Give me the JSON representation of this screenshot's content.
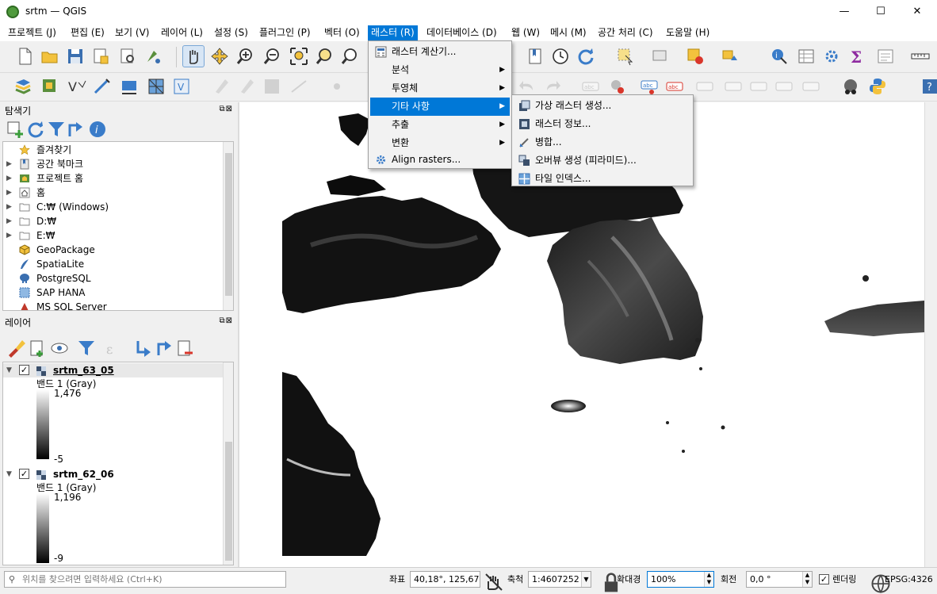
{
  "window": {
    "title": "srtm — QGIS",
    "minimize": "—",
    "maximize": "☐",
    "close": "✕"
  },
  "menubar": [
    "프로젝트 (J)",
    "편집 (E)",
    "보기 (V)",
    "레이어 (L)",
    "설정 (S)",
    "플러그인 (P)",
    "벡터 (O)",
    "래스터 (R)",
    "데이터베이스 (D)",
    "웹 (W)",
    "메시 (M)",
    "공간 처리 (C)",
    "도움말 (H)"
  ],
  "raster_menu": {
    "items": [
      "래스터 계산기...",
      "분석",
      "투영체",
      "기타 사항",
      "추출",
      "변환",
      "Align rasters..."
    ],
    "highlighted": "기타 사항"
  },
  "misc_submenu": {
    "items": [
      "가상 래스터 생성...",
      "래스터 정보...",
      "병합...",
      "오버뷰 생성 (피라미드)...",
      "타일 인덱스..."
    ]
  },
  "browser_panel": {
    "title": "탐색기",
    "items": [
      "즐겨찾기",
      "공간 북마크",
      "프로젝트 홈",
      "홈",
      "C:₩ (Windows)",
      "D:₩",
      "E:₩",
      "GeoPackage",
      "SpatiaLite",
      "PostgreSQL",
      "SAP HANA",
      "MS SQL Server"
    ]
  },
  "layers_panel": {
    "title": "레이어",
    "layers": [
      {
        "name": "srtm_63_05",
        "band": "밴드 1 (Gray)",
        "max": "1,476",
        "min": "-5"
      },
      {
        "name": "srtm_62_06",
        "band": "밴드 1 (Gray)",
        "max": "1,196",
        "min": "-9"
      }
    ]
  },
  "statusbar": {
    "search_placeholder": "위치를 찾으려면 입력하세요 (Ctrl+K)",
    "coord_label": "좌표",
    "coord_value": "40,18°, 125,67°",
    "scale_label": "축척",
    "scale_value": "1:4607252",
    "magnifier_label": "확대경",
    "magnifier_value": "100%",
    "rotation_label": "회전",
    "rotation_value": "0,0 °",
    "render_label": "렌더링",
    "crs": "EPSG:4326"
  },
  "colors": {
    "accent": "#0078d7",
    "map_bg": "#ffffff"
  }
}
